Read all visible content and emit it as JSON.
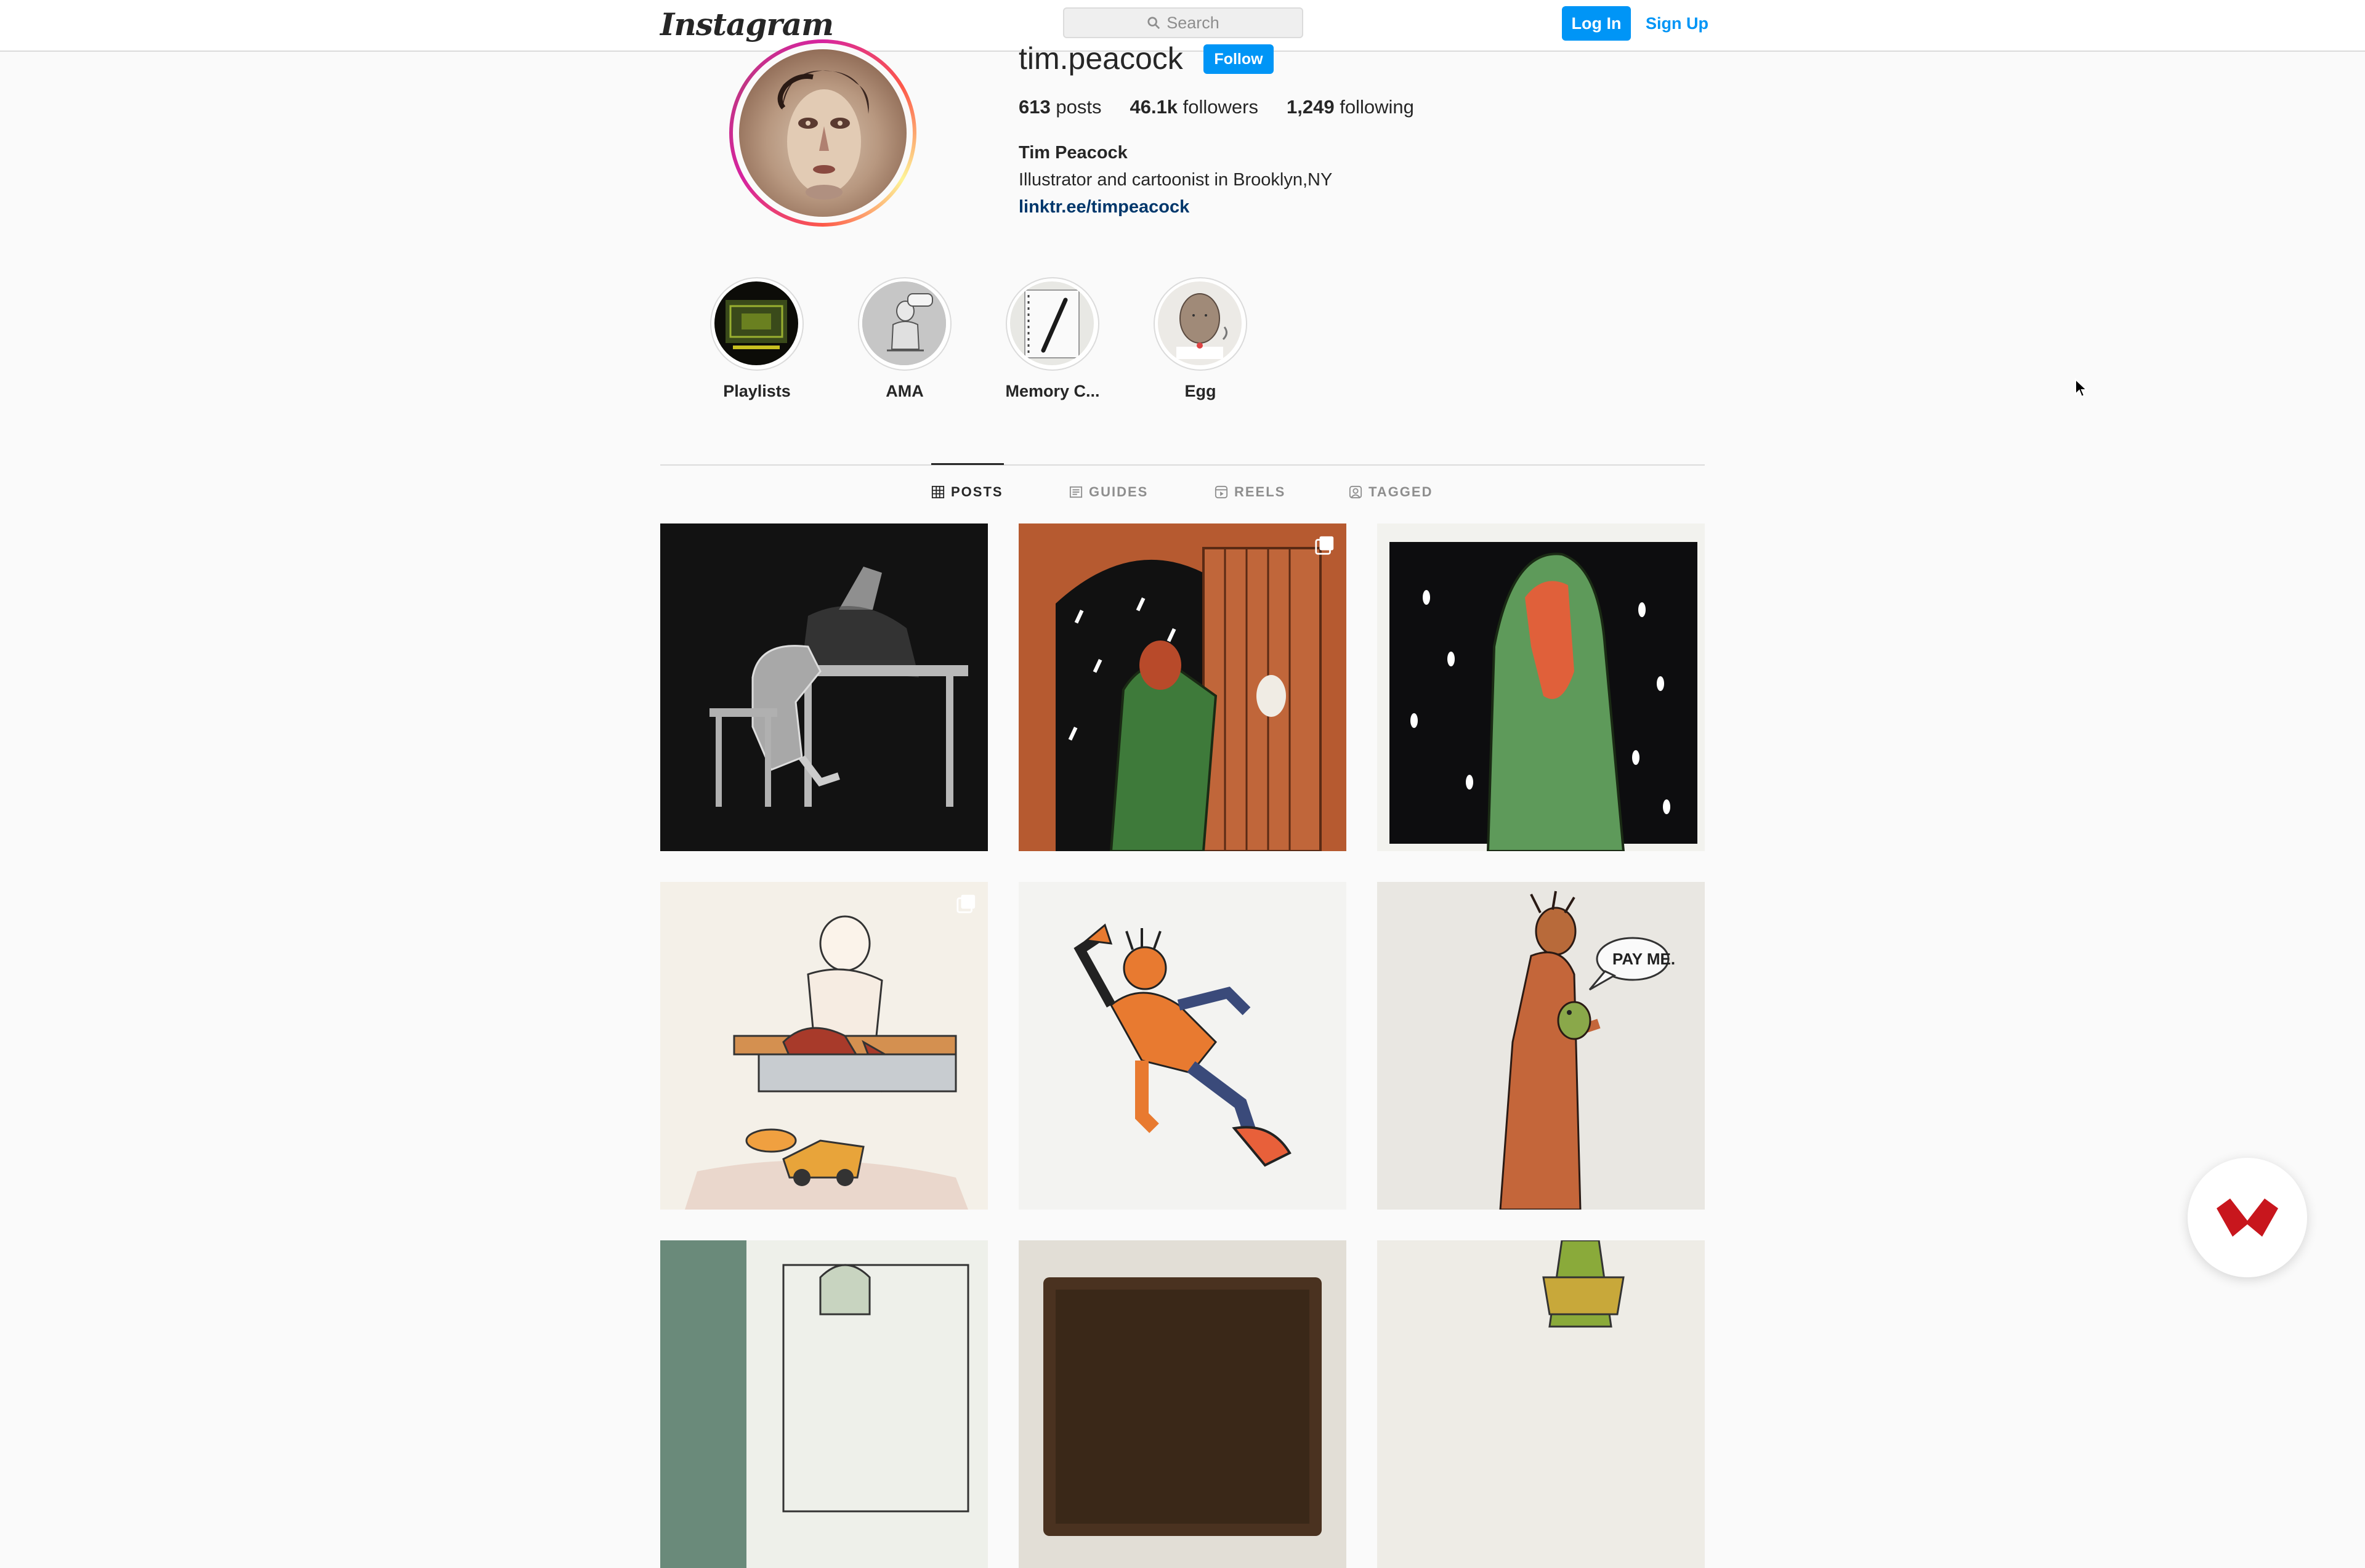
{
  "app": {
    "name": "Instagram"
  },
  "nav": {
    "logo_text": "Instagram",
    "search_placeholder": "Search",
    "login_label": "Log In",
    "signup_label": "Sign Up",
    "accent_color": "#0095f6"
  },
  "profile": {
    "username": "tim.peacock",
    "follow_label": "Follow",
    "stats": [
      {
        "count": "613",
        "label": "posts"
      },
      {
        "count": "46.1k",
        "label": "followers"
      },
      {
        "count": "1,249",
        "label": "following"
      }
    ],
    "full_name": "Tim Peacock",
    "bio": "Illustrator and cartoonist in Brooklyn,NY",
    "link": "linktr.ee/timpeacock"
  },
  "highlights": [
    {
      "label": "Playlists"
    },
    {
      "label": "AMA"
    },
    {
      "label": "Memory C..."
    },
    {
      "label": "Egg"
    }
  ],
  "tabs": [
    {
      "label": "POSTS",
      "icon": "grid-icon",
      "active": true
    },
    {
      "label": "GUIDES",
      "icon": "guide-icon",
      "active": false
    },
    {
      "label": "REELS",
      "icon": "reels-icon",
      "active": false
    },
    {
      "label": "TAGGED",
      "icon": "tagged-icon",
      "active": false
    }
  ],
  "posts": [
    {
      "subject": "figure slumped at desk under lamp",
      "multi": false
    },
    {
      "subject": "man in green coat in doorway, snow",
      "multi": true
    },
    {
      "subject": "hooded figure in snow",
      "multi": false
    },
    {
      "subject": "boy on bench with toy car",
      "multi": true
    },
    {
      "subject": "figure tumbling in orange",
      "multi": false
    },
    {
      "subject": "figure holding small creature saying PAY ME",
      "multi": false,
      "speech": "PAY ME."
    },
    {
      "subject": "street scene",
      "multi": false
    },
    {
      "subject": "dark painting",
      "multi": false
    },
    {
      "subject": "green figure",
      "multi": false
    }
  ]
}
